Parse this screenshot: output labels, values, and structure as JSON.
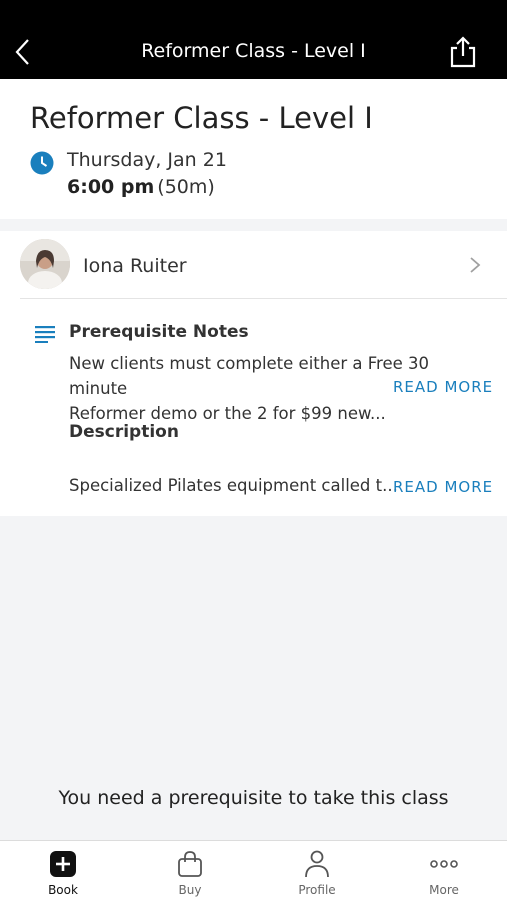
{
  "top_bar": {
    "title": "Reformer Class - Level I",
    "back_icon": "chevron-left-icon",
    "share_icon": "share-icon"
  },
  "class": {
    "title": "Reformer Class - Level I",
    "date": "Thursday, Jan 21",
    "time": "6:00 pm",
    "duration": "(50m)"
  },
  "instructor": {
    "name": "Iona Ruiter"
  },
  "prerequisite": {
    "title": "Prerequisite Notes",
    "line1": "New clients must complete either a Free 30 minute",
    "line2": "Reformer demo or the 2 for $99 new...",
    "read_more": "READ MORE"
  },
  "description": {
    "title": "Description",
    "text": "Specialized Pilates equipment called t...",
    "read_more": "READ MORE"
  },
  "message": "You need a prerequisite to take this class",
  "tabs": [
    {
      "label": "Book",
      "icon": "plus-square-icon",
      "active": true
    },
    {
      "label": "Buy",
      "icon": "shopping-bag-icon",
      "active": false
    },
    {
      "label": "Profile",
      "icon": "person-icon",
      "active": false
    },
    {
      "label": "More",
      "icon": "ellipsis-icon",
      "active": false
    }
  ],
  "colors": {
    "accent": "#1a7fbd",
    "top_bar": "#000000"
  }
}
